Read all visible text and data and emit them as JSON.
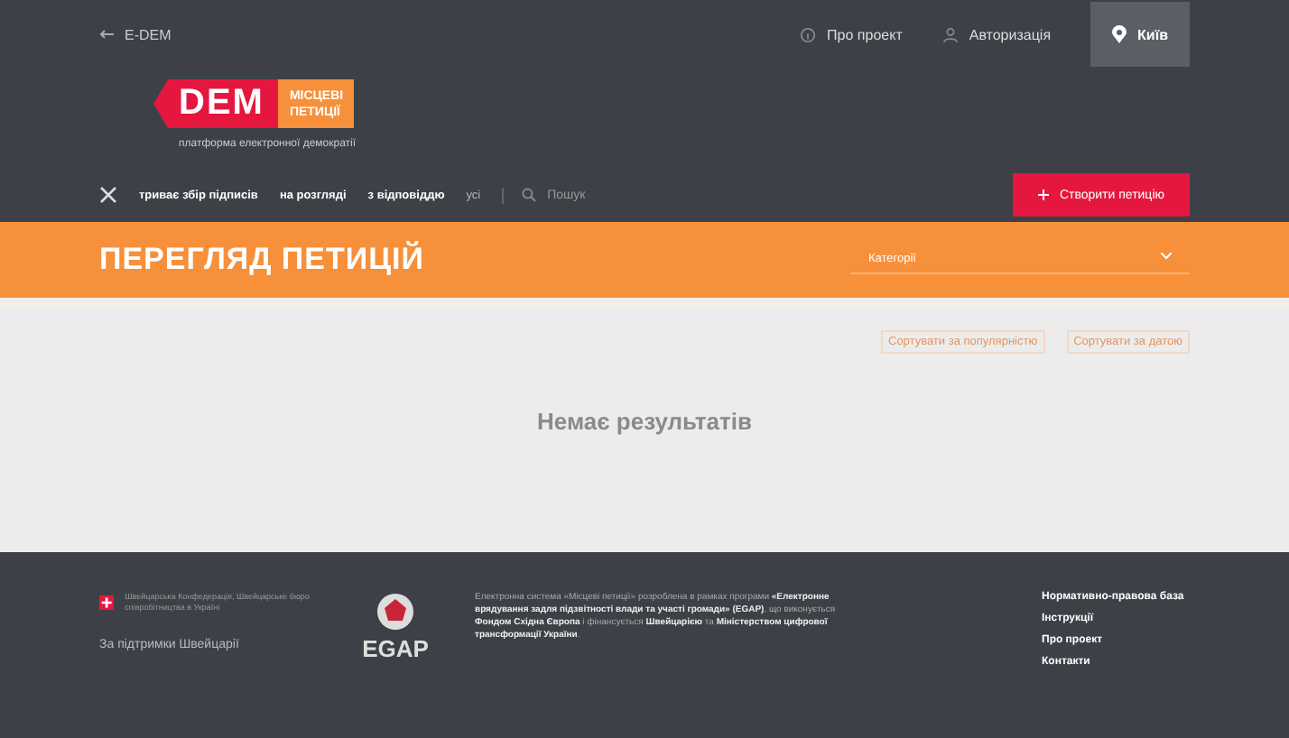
{
  "topbar": {
    "back_link": "E-DEM",
    "links": [
      {
        "label": "Про проект",
        "kind": "info"
      },
      {
        "label": "Авторизація",
        "kind": "account"
      }
    ],
    "city": "Київ"
  },
  "logo": {
    "mark": "DEM",
    "badge_lines": [
      "МІСЦЕВІ",
      "ПЕТИЦІЇ"
    ],
    "tagline": "платформа електронної демократії"
  },
  "nav": {
    "filters": [
      {
        "label": "триває збір підписів",
        "selected": false
      },
      {
        "label": "на розгляді",
        "selected": false
      },
      {
        "label": "з відповіддю",
        "selected": false
      },
      {
        "label": "усі",
        "selected": true
      }
    ],
    "search": {
      "placeholder": "Пошук"
    },
    "create_button": "Створити петицію"
  },
  "banner": {
    "title": "ПЕРЕГЛЯД ПЕТИЦІЙ",
    "category_select": {
      "placeholder": "Категорії"
    }
  },
  "sort_links": [
    "Сортувати за популярністю",
    "Сортувати за датою"
  ],
  "empty_message": "Немає результатів",
  "footer": {
    "swiss_text": "Швейцарська Конфедерація, Швейцарське бюро співробітництва в Україні",
    "support": "За підтримки Швейцарії",
    "egap": "EGAP",
    "about": "Електронна система «Місцеві петиції» розроблена в рамках програми **«Електронне врядування задля підзвітності влади та участі громади» (EGAP)**, що виконується **Фондом Східна Європа** і фінансується **Швейцарією** та **Міністерством цифрової трансформації України**.",
    "links": [
      "Нормативно-правова база",
      "Інструкції",
      "Про проект",
      "Контакти"
    ]
  }
}
